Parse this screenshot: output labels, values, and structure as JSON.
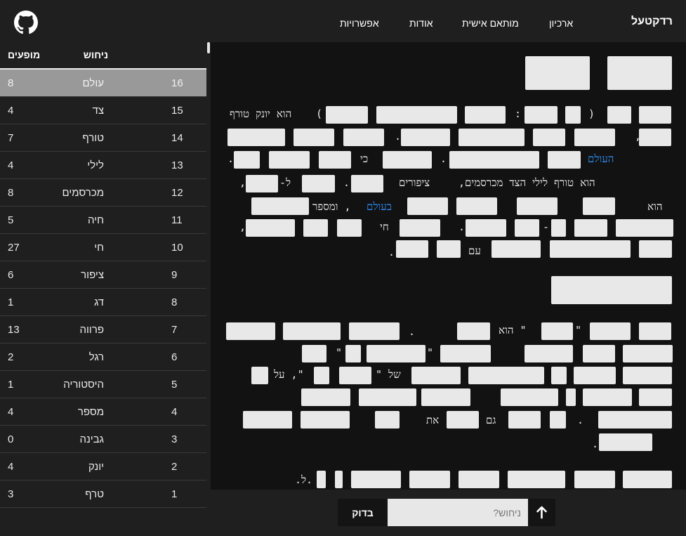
{
  "header": {
    "brand": "רדקטעל",
    "nav": {
      "archive": "ארכיון",
      "custom": "מותאם אישית",
      "about": "אודות",
      "options": "אפשרויות"
    },
    "github_icon": "github-icon"
  },
  "sidebar": {
    "col_guess": "ניחוש",
    "col_hits": "מופעים",
    "rows": [
      {
        "n": "16",
        "word": "עולם",
        "hits": "8"
      },
      {
        "n": "15",
        "word": "צד",
        "hits": "4"
      },
      {
        "n": "14",
        "word": "טורף",
        "hits": "7"
      },
      {
        "n": "13",
        "word": "לילי",
        "hits": "4"
      },
      {
        "n": "12",
        "word": "מכרסמים",
        "hits": "8"
      },
      {
        "n": "11",
        "word": "חיה",
        "hits": "5"
      },
      {
        "n": "10",
        "word": "חי",
        "hits": "27"
      },
      {
        "n": "9",
        "word": "ציפור",
        "hits": "6"
      },
      {
        "n": "8",
        "word": "דג",
        "hits": "1"
      },
      {
        "n": "7",
        "word": "פרווה",
        "hits": "13"
      },
      {
        "n": "6",
        "word": "רגל",
        "hits": "2"
      },
      {
        "n": "5",
        "word": "היסטוריה",
        "hits": "1"
      },
      {
        "n": "4",
        "word": "מספר",
        "hits": "4"
      },
      {
        "n": "3",
        "word": "גבינה",
        "hits": "0"
      },
      {
        "n": "2",
        "word": "יונק",
        "hits": "4"
      },
      {
        "n": "1",
        "word": "טרף",
        "hits": "3"
      }
    ]
  },
  "article": {
    "p1": {
      "open_paren": "(",
      "colon": ":",
      "close_paren": ")",
      "is_mammal_predator": "הוא יונק טורף",
      "comma": ",",
      "dot": ".",
      "the_world": "העולם",
      "ki": "כי",
      "nocturnal_predator": "הוא טורף לילי הצד מכרסמים,",
      "birds": "ציפורים",
      "le": "ל-",
      "hu": "הוא",
      "in_world": "בעולם",
      "and_number": ", ומספר",
      "dash": "-",
      "chai": "חי",
      "im": "עם"
    },
    "p2": {
      "quote": "\"",
      "hu_quote": "\" הוא",
      "shel": "של \"",
      "al": "\", על",
      "colon_quote": ": \"",
      "gam": "גם",
      "et": "את",
      "abbrev": ".ל."
    }
  },
  "guess_bar": {
    "button": "בדוק",
    "placeholder": "ניחוש?",
    "arrow_icon": "arrow-up-icon"
  }
}
